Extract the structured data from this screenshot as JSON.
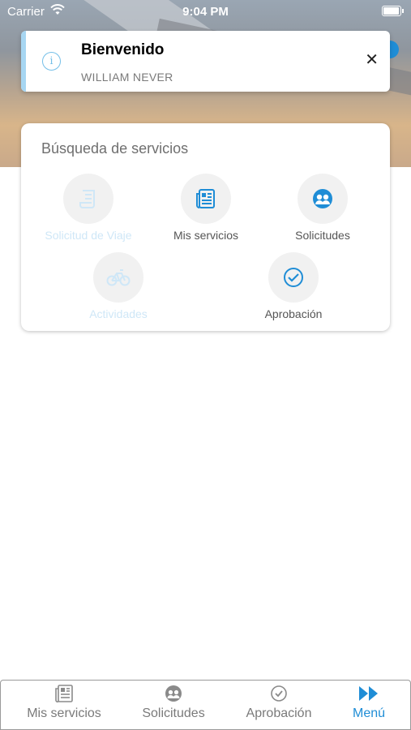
{
  "status_bar": {
    "carrier": "Carrier",
    "time": "9:04 PM"
  },
  "toast": {
    "title": "Bienvenido",
    "subtitle": "WILLIAM NEVER"
  },
  "services": {
    "title": "Búsqueda de servicios",
    "items": [
      {
        "label": "Solicitud de Viaje",
        "icon": "document-icon",
        "enabled": false
      },
      {
        "label": "Mis servicios",
        "icon": "newspaper-icon",
        "enabled": true
      },
      {
        "label": "Solicitudes",
        "icon": "group-icon",
        "enabled": true
      },
      {
        "label": "Actividades",
        "icon": "bicycle-icon",
        "enabled": false
      },
      {
        "label": "Aprobación",
        "icon": "check-circle-icon",
        "enabled": true
      }
    ]
  },
  "tabbar": {
    "items": [
      {
        "label": "Mis servicios",
        "icon": "newspaper-icon",
        "active": false
      },
      {
        "label": "Solicitudes",
        "icon": "group-icon",
        "active": false
      },
      {
        "label": "Aprobación",
        "icon": "check-circle-icon",
        "active": false
      },
      {
        "label": "Menú",
        "icon": "fast-forward-icon",
        "active": true
      }
    ]
  },
  "colors": {
    "accent": "#1f8dd6",
    "disabled": "#cfe7f7",
    "info_bar": "#a7d6f2"
  }
}
